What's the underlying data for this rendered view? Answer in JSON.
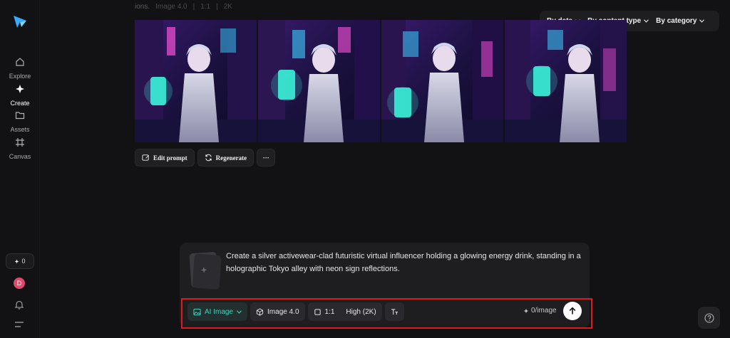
{
  "sidebar": {
    "logo_icon": "star-arrow-logo",
    "items": [
      {
        "label": "Explore",
        "icon": "home-icon"
      },
      {
        "label": "Create",
        "icon": "sparkle-icon"
      },
      {
        "label": "Assets",
        "icon": "folder-icon"
      },
      {
        "label": "Canvas",
        "icon": "frame-icon"
      }
    ],
    "credits": "0",
    "avatar_initial": "D"
  },
  "meta": {
    "prompt_tail": "ions.",
    "model": "Image 4.0",
    "ratio": "1:1",
    "resolution": "2K"
  },
  "filters": [
    {
      "label": "By date"
    },
    {
      "label": "By content type"
    },
    {
      "label": "By category"
    }
  ],
  "actions": {
    "edit_prompt": "Edit prompt",
    "regenerate": "Regenerate",
    "more": "···"
  },
  "prompt": {
    "attach_icon": "+",
    "text": "Create a silver activewear-clad futuristic virtual influencer holding a glowing energy drink, standing in a holographic Tokyo alley with neon sign reflections."
  },
  "toolbar": {
    "type": "AI Image",
    "model": "Image 4.0",
    "ratio": "1:1",
    "quality": "High (2K)",
    "cost": "0/image"
  },
  "colors": {
    "accent_teal": "#3fd4c0",
    "highlight_red": "#d81c24",
    "avatar": "#e0496b"
  }
}
